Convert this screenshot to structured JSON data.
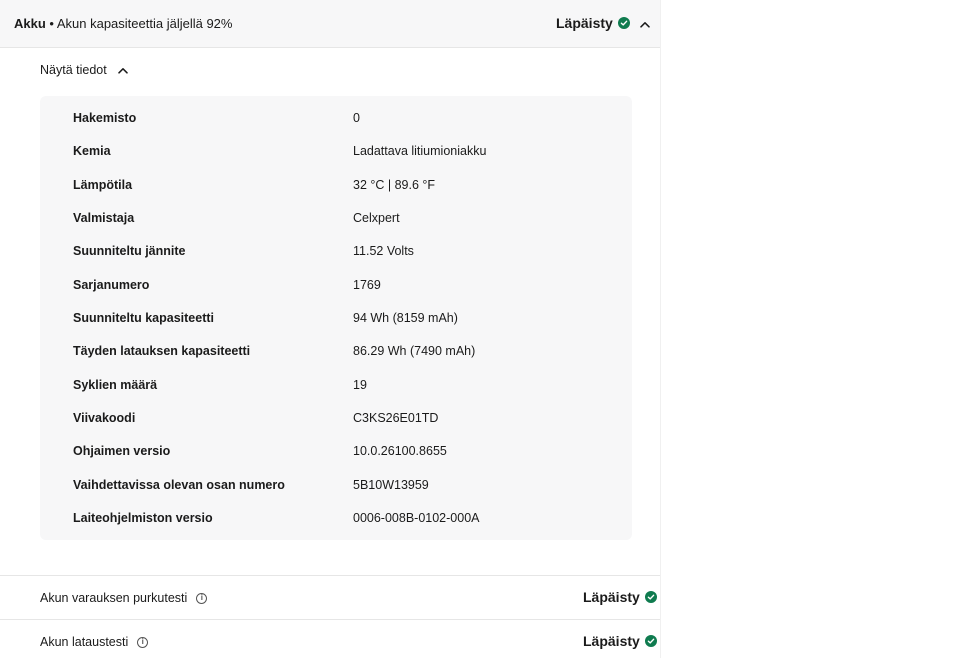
{
  "header": {
    "title_strong": "Akku",
    "title_sep": " • ",
    "title_rest": "Akun kapasiteettia jäljellä 92%",
    "status": "Läpäisty"
  },
  "toggle": {
    "label": "Näytä tiedot",
    "icon": "chevron-up-icon"
  },
  "details": [
    {
      "key": "Hakemisto",
      "value": "0"
    },
    {
      "key": "Kemia",
      "value": "Ladattava litiumioniakku"
    },
    {
      "key": "Lämpötila",
      "value": "32 °C | 89.6 °F"
    },
    {
      "key": "Valmistaja",
      "value": "Celxpert"
    },
    {
      "key": "Suunniteltu jännite",
      "value": "11.52 Volts"
    },
    {
      "key": "Sarjanumero",
      "value": "1769"
    },
    {
      "key": "Suunniteltu kapasiteetti",
      "value": "94 Wh (8159 mAh)"
    },
    {
      "key": "Täyden latauksen kapasiteetti",
      "value": "86.29 Wh (7490 mAh)"
    },
    {
      "key": "Syklien määrä",
      "value": "19"
    },
    {
      "key": "Viivakoodi",
      "value": "C3KS26E01TD"
    },
    {
      "key": "Ohjaimen versio",
      "value": "10.0.26100.8655"
    },
    {
      "key": "Vaihdettavissa olevan osan numero",
      "value": "5B10W13959"
    },
    {
      "key": "Laiteohjelmiston versio",
      "value": "0006-008B-0102-000A"
    }
  ],
  "tests": [
    {
      "label": "Akun varauksen purkutesti",
      "status": "Läpäisty"
    },
    {
      "label": "Akun lataustesti",
      "status": "Läpäisty"
    }
  ],
  "colors": {
    "pass": "#0f7b4f",
    "panel_bg": "#f7f7f8"
  },
  "icons": {
    "status": "check-circle-icon",
    "info": "info-icon",
    "collapse": "chevron-up-icon"
  }
}
